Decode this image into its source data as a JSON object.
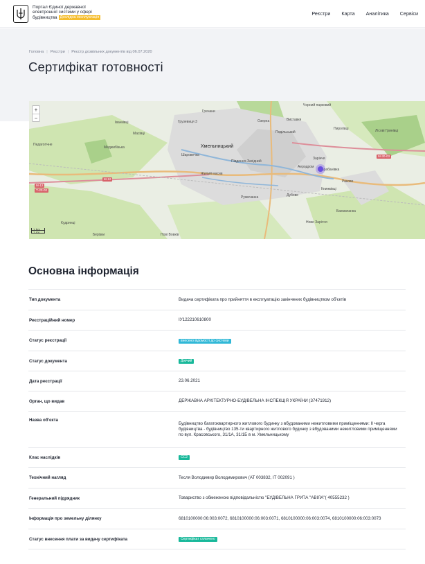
{
  "header": {
    "logo_line1": "Портал Єдиної державної",
    "logo_line2": "електронної системи у сфері",
    "logo_line3": "будівництва",
    "beta_label": "Дослідна експлуатація",
    "nav": [
      "Реєстри",
      "Карта",
      "Аналітика",
      "Сервіси"
    ]
  },
  "breadcrumb": [
    "Головна",
    "Реєстри",
    "Реєстр дозвільних документів від 06.07.2020"
  ],
  "page_title": "Сертифікат готовності",
  "map": {
    "zoom_in": "+",
    "zoom_out": "−",
    "scale_km": "2 km",
    "scale_mi": "1 mi",
    "city": "Хмельницький",
    "labels": [
      "Гречани",
      "Грузевиця 3",
      "Іванківці",
      "Чорний парковий",
      "Виставки",
      "Озерна",
      "Пирогівці",
      "Лісові Гринівці",
      "Масівці",
      "Шаровечка",
      "Подільський",
      "Педагогічне",
      "Меджибізька",
      "Жилий масив",
      "Південно-Західний",
      "Дубове",
      "Ракове",
      "Тарабанівка",
      "Аеродром",
      "Заріччя",
      "Книжківці",
      "Бахмачанка",
      "Ружичанка",
      "Нове Заріччя",
      "Кудринці",
      "Берізки",
      "Нові Вовків"
    ],
    "roads": [
      "М-12",
      "Т-23-02",
      "М-30-03",
      "М-12"
    ]
  },
  "section_title": "Основна інформація",
  "info": [
    {
      "key": "Тип документа",
      "value": "Видача сертифіката про прийняття в експлуатацію закінчених будівництвом об'єктів"
    },
    {
      "key": "Реєстраційний номер",
      "value": "ІУ122210610800"
    },
    {
      "key": "Статус реєстрації",
      "badge": "внесено відомості до системи",
      "badge_color": "#31b8d7"
    },
    {
      "key": "Статус документа",
      "badge": "Діючий",
      "badge_color": "#18b89a"
    },
    {
      "key": "Дата реєстрації",
      "value": "23.06.2021"
    },
    {
      "key": "Орган, що видав",
      "value": "ДЕРЖАВНА АРХІТЕКТУРНО-БУДІВЕЛЬНА ІНСПЕКЦІЯ УКРАЇНИ (37471912)"
    },
    {
      "key": "Назва об'єкта",
      "value": "Будівництво багатоквартирного житлового будинку з вбудованими нежитловими приміщеннями: ІІ черга будівництва - будівництво 135-ти квартирного житлового будинку з вбудованими нежитловими приміщеннями по вул. Красовського, 31/1А, 31/1Б в м. Хмельницькому"
    },
    {
      "key": "Клас наслідків",
      "badge": "СС2",
      "badge_color": "#18b89a"
    },
    {
      "key": "Технічний нагляд",
      "value": "Тесля Володимир Володимирович (АТ 003832, ІТ 002091 )"
    },
    {
      "key": "Генеральний підрядник",
      "value": "Товариство з обмеженою відповідальністю \"БУДІВЕЛЬНА ГРУПА \"АВІЛА\"( 40555232 )"
    },
    {
      "key": "Інформація про земельну ділянку",
      "value": "6810100000:06:003:0072, 6810100000:06:003:0071, 6810100000:06:003:0074, 6810100000:06:003:0073"
    },
    {
      "key": "Статус внесення плати за видачу сертифіката",
      "badge": "Сертифікат сплачено",
      "badge_color": "#18b89a"
    }
  ]
}
